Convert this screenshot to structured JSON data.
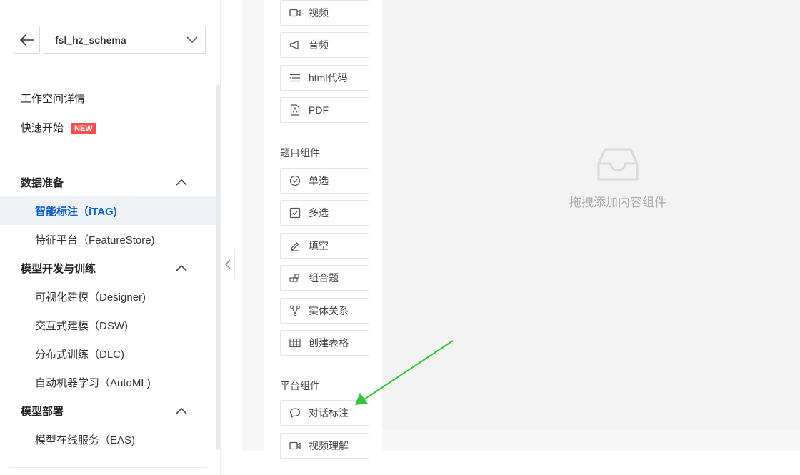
{
  "sidebar": {
    "workspace": "fsl_hz_schema",
    "top_links": [
      {
        "label": "工作空间详情"
      },
      {
        "label": "快速开始",
        "badge": "NEW"
      }
    ],
    "groups": [
      {
        "label": "数据准备",
        "items": [
          "智能标注（iTAG)",
          "特征平台（FeatureStore)"
        ]
      },
      {
        "label": "模型开发与训练",
        "items": [
          "可视化建模（Designer)",
          "交互式建模（DSW)",
          "分布式训练（DLC)",
          "自动机器学习（AutoML)"
        ]
      },
      {
        "label": "模型部署",
        "items": [
          "模型在线服务（EAS)"
        ]
      }
    ],
    "active_item": "智能标注（iTAG)"
  },
  "palette": {
    "content_components": [
      "视频",
      "音频",
      "html代码",
      "PDF"
    ],
    "question_section_title": "题目组件",
    "question_components": [
      "单选",
      "多选",
      "填空",
      "组合题",
      "实体关系",
      "创建表格"
    ],
    "platform_section_title": "平台组件",
    "platform_components": [
      "对话标注",
      "视频理解"
    ]
  },
  "canvas": {
    "empty_text": "拖拽添加内容组件"
  },
  "colors": {
    "accent": "#0d5fc9",
    "badge": "#f5504f",
    "annotation_arrow": "#34c33b"
  }
}
